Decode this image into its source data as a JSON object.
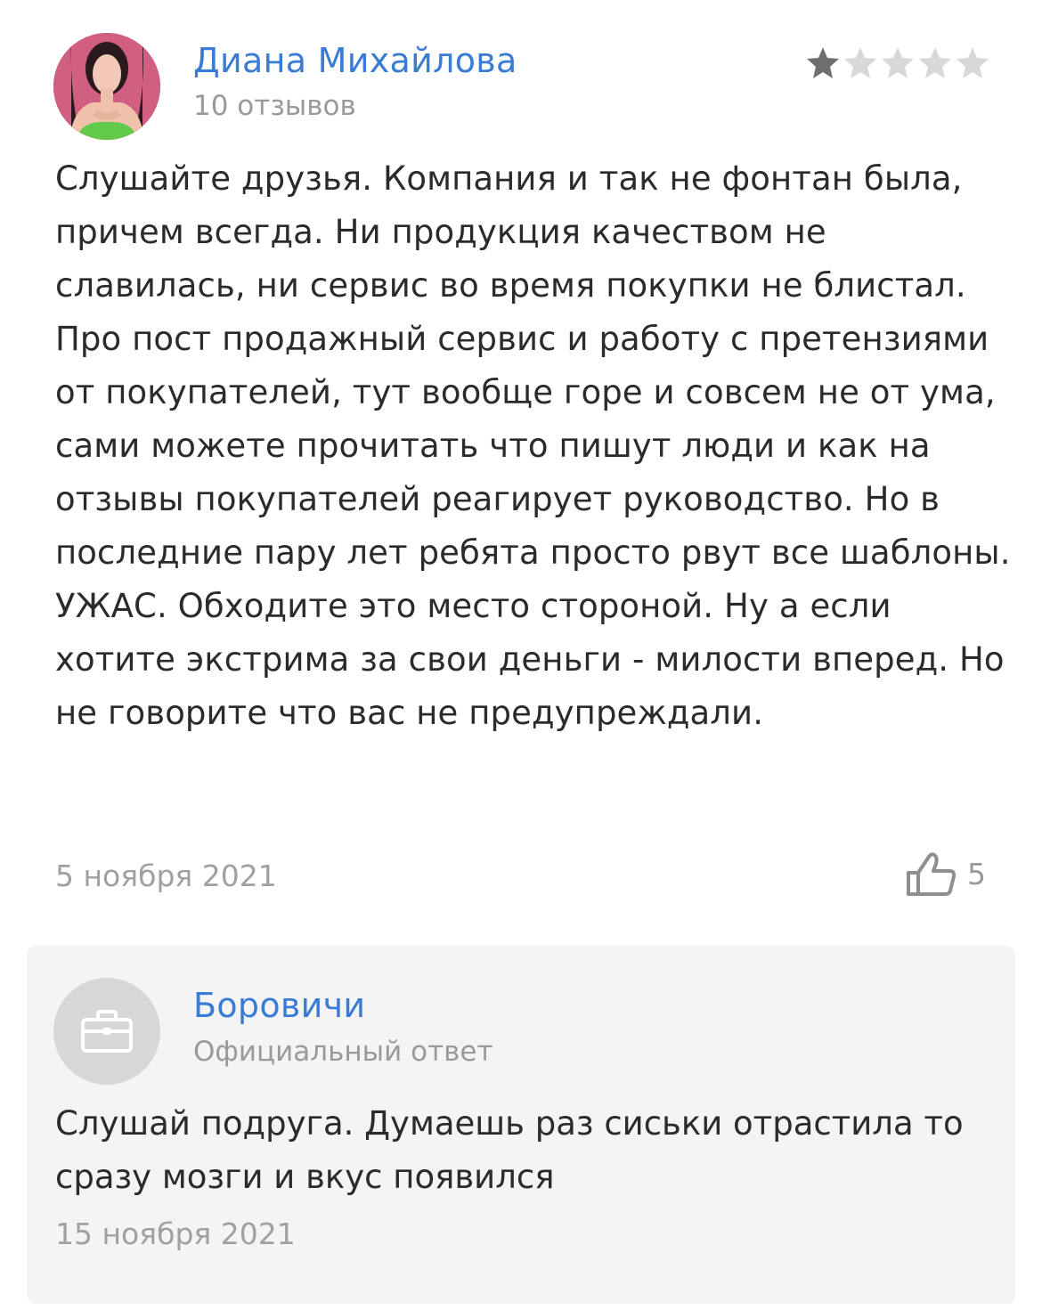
{
  "review": {
    "author_name": "Диана Михайлова",
    "author_reviews": "10 отзывов",
    "rating": 1,
    "rating_max": 5,
    "text": "Слушайте друзья. Компания и так не фонтан была, причем всегда. Ни продукция качеством не славилась, ни сервис во время покупки не блистал. Про пост продажный сервис и работу с претензиями от покупателей, тут вообще горе и совсем не от ума, сами можете прочитать что пишут люди и как на отзывы покупателей реагирует руководство. Но в последние пару лет ребята просто рвут все шаблоны. УЖАС. Обходите это место стороной. Ну а если хотите экстрима за свои деньги - милости вперед. Но не говорите что вас не предупреждали.",
    "date": "5 ноября 2021",
    "likes": "5"
  },
  "reply": {
    "author_name": "Боровичи",
    "author_sub": "Официальный ответ",
    "text": "Слушай подруга. Думаешь раз сиськи отрастила то сразу мозги и вкус появился",
    "date": "15 ноября 2021"
  },
  "colors": {
    "link": "#3a7bd5",
    "muted": "#9a9a9a",
    "text": "#2b2b2b",
    "star_filled": "#6f6f6f",
    "star_empty": "#d8d8d8",
    "reply_bg": "#f4f4f4"
  },
  "icons": {
    "like": "thumbs-up-icon",
    "star": "star-icon",
    "reply_avatar": "briefcase-icon"
  }
}
